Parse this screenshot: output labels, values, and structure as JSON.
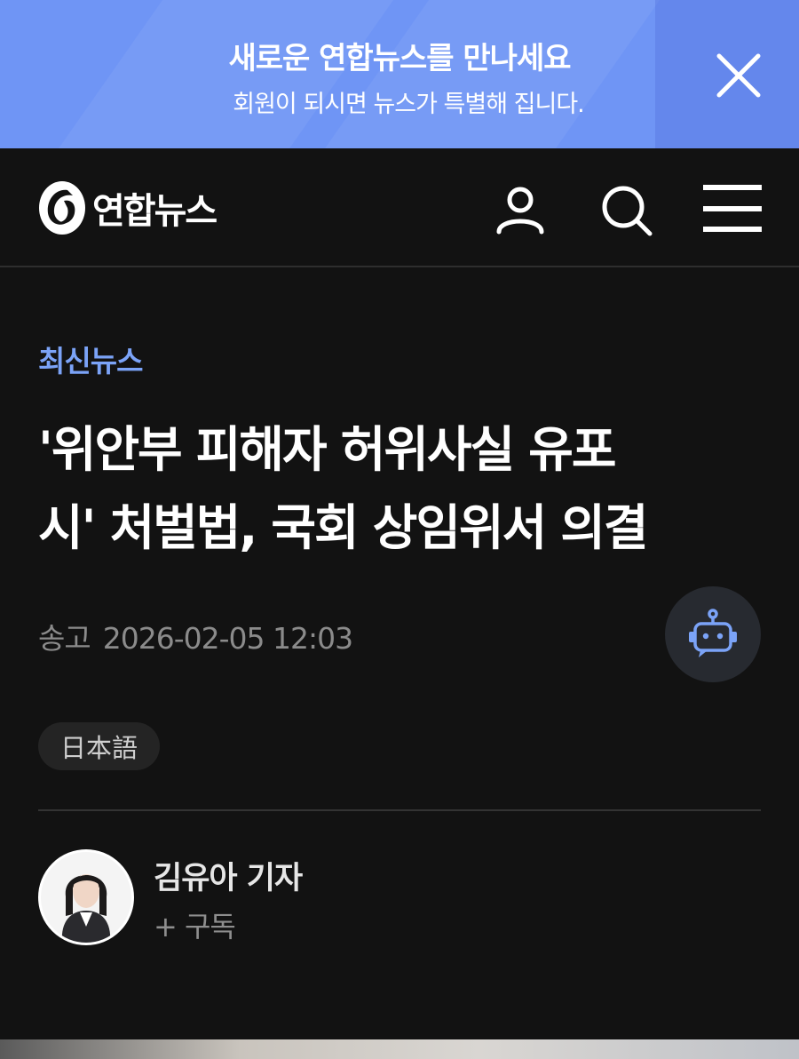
{
  "promo": {
    "title": "새로운 연합뉴스를 만나세요",
    "subtitle": "회원이 되시면 뉴스가 특별해 집니다.",
    "close_icon": "close-icon",
    "background_color": "#6f95f5"
  },
  "header": {
    "logo_text": "연합뉴스",
    "icons": [
      "user-icon",
      "search-icon",
      "menu-icon"
    ]
  },
  "article": {
    "category": "최신뉴스",
    "headline_line1": "'위안부 피해자 허위사실 유포",
    "headline_line2": "시' 처벌법, 국회 상임위서 의결",
    "date_label": "송고",
    "date_value": "2026-02-05 12:03",
    "language_chip": "日本語",
    "ai_icon": "robot-icon",
    "accent_color": "#7ba3f7"
  },
  "reporter": {
    "name": "김유아 기자",
    "subscribe": "+ 구독"
  }
}
